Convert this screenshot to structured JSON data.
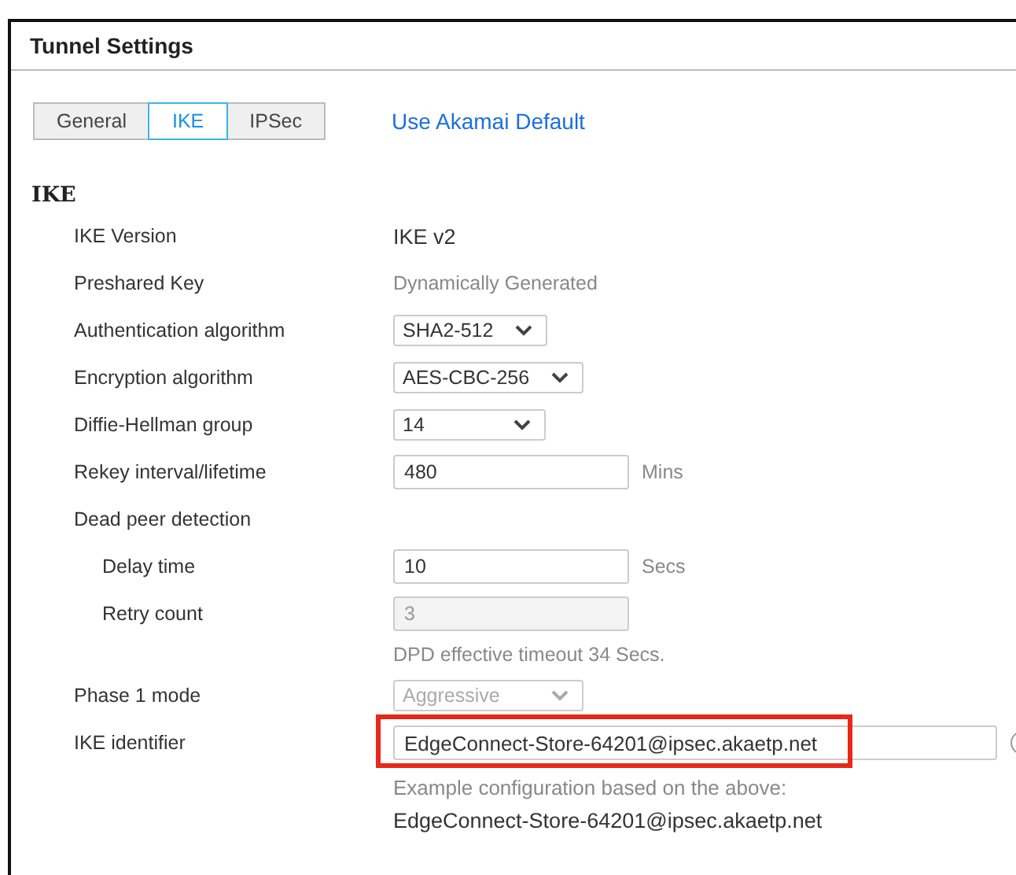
{
  "panel": {
    "title": "Tunnel Settings"
  },
  "tabs": [
    {
      "label": "General",
      "selected": false
    },
    {
      "label": "IKE",
      "selected": true
    },
    {
      "label": "IPSec",
      "selected": false
    }
  ],
  "default_link": "Use Akamai Default",
  "section": "IKE",
  "rows": [
    {
      "kind": "text",
      "label": "IKE Version",
      "value": "IKE v2"
    },
    {
      "kind": "muted",
      "label": "Preshared Key",
      "value": "Dynamically Generated"
    },
    {
      "kind": "select",
      "label": "Authentication algorithm",
      "value": "SHA2-512",
      "disabled": false
    },
    {
      "kind": "select",
      "label": "Encryption algorithm",
      "value": "AES-CBC-256",
      "disabled": false
    },
    {
      "kind": "select",
      "label": "Diffie-Hellman group",
      "value": "14",
      "disabled": false
    },
    {
      "kind": "input",
      "label": "Rekey interval/lifetime",
      "value": "480",
      "unit": "Mins",
      "disabled": false
    },
    {
      "kind": "group",
      "label": "Dead peer detection",
      "children": [
        {
          "kind": "input",
          "label": "Delay time",
          "value": "10",
          "unit": "Secs",
          "disabled": false
        },
        {
          "kind": "input",
          "label": "Retry count",
          "value": "3",
          "disabled": true
        },
        {
          "kind": "note",
          "value": "DPD effective timeout 34 Secs."
        }
      ]
    },
    {
      "kind": "select",
      "label": "Phase 1 mode",
      "value": "Aggressive",
      "disabled": true
    },
    {
      "kind": "input",
      "label": "IKE identifier",
      "value": "EdgeConnect-Store-64201@ipsec.akaetp.net",
      "disabled": false,
      "highlighted": true,
      "info": true
    },
    {
      "kind": "example",
      "caption": "Example configuration based on the above:",
      "value": "EdgeConnect-Store-64201@ipsec.akaetp.net"
    }
  ]
}
